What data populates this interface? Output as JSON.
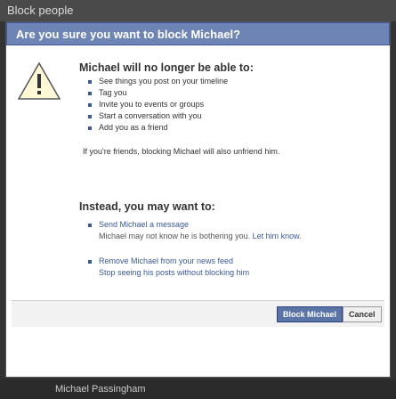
{
  "outer_header": {
    "title": "Block people"
  },
  "dialog": {
    "title": "Are you sure you want to block Michael?",
    "warning": {
      "heading": "Michael will no longer be able to:",
      "items": [
        "See things you post on your timeline",
        "Tag you",
        "Invite you to events or groups",
        "Start a conversation with you",
        "Add you as a friend"
      ],
      "note": "If you're friends, blocking Michael will also unfriend him."
    },
    "alternatives": {
      "heading": "Instead, you may want to:",
      "items": [
        {
          "label": "Send Michael a message",
          "subtext": "Michael may not know he is bothering you.",
          "link": "Let him know."
        },
        {
          "label": "Remove Michael from your news feed",
          "link": "Stop seeing his posts without blocking him"
        }
      ]
    },
    "buttons": {
      "primary": "Block Michael",
      "secondary": "Cancel"
    }
  },
  "footer": {
    "name": "Michael Passingham"
  },
  "colors": {
    "title_bar": "#6d84b4",
    "title_border": "#3b5998",
    "primary_button": "#5b74a8",
    "link": "#3b5998"
  },
  "icons": {
    "warning": "warning-icon"
  }
}
